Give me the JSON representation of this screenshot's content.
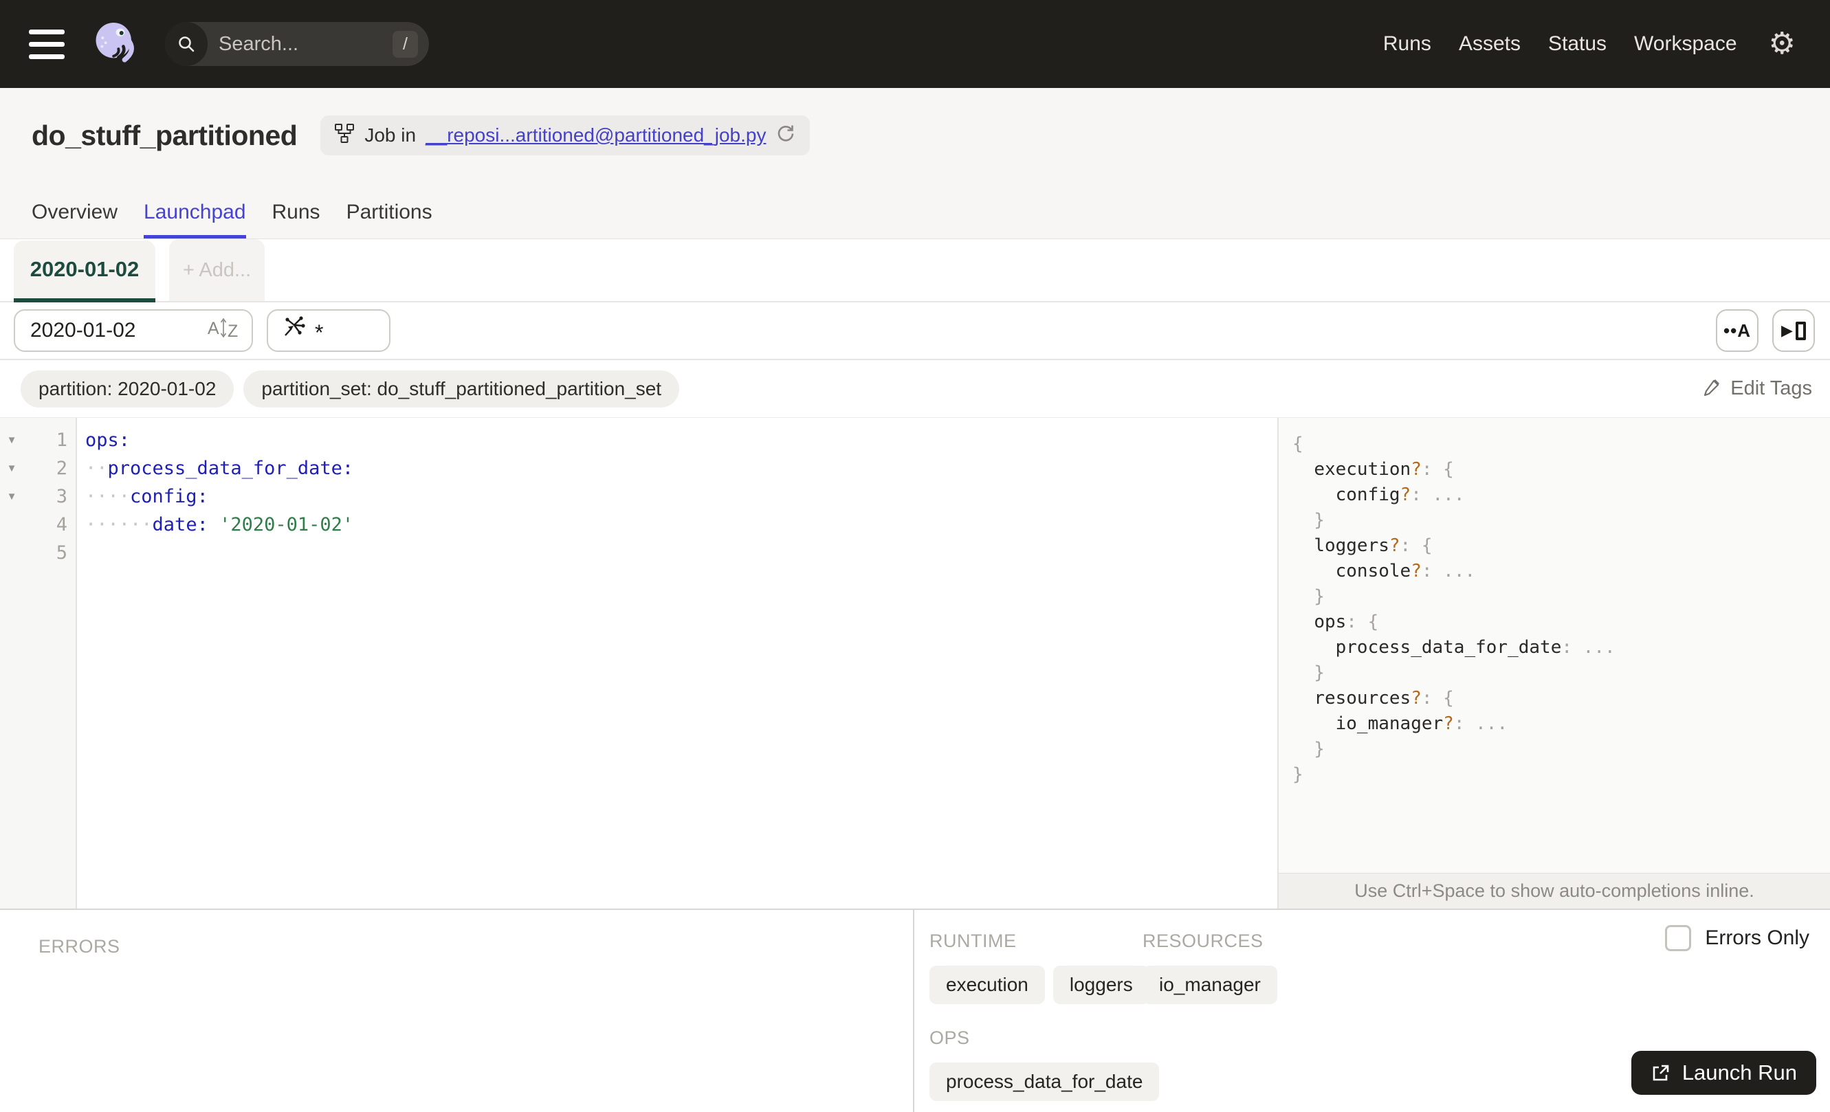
{
  "topbar": {
    "search_placeholder": "Search...",
    "shortcut_key": "/",
    "nav_items": [
      "Runs",
      "Assets",
      "Status",
      "Workspace"
    ]
  },
  "header": {
    "title": "do_stuff_partitioned",
    "job_badge_prefix": "Job in",
    "job_badge_link": "__reposi...artitioned@partitioned_job.py"
  },
  "tabs": [
    {
      "label": "Overview",
      "active": false
    },
    {
      "label": "Launchpad",
      "active": true
    },
    {
      "label": "Runs",
      "active": false
    },
    {
      "label": "Partitions",
      "active": false
    }
  ],
  "partition_tabs": {
    "active_label": "2020-01-02",
    "add_label": "+ Add..."
  },
  "toolbar": {
    "partition_value": "2020-01-02",
    "op_filter_value": "*"
  },
  "tags": {
    "items": [
      "partition: 2020-01-02",
      "partition_set: do_stuff_partitioned_partition_set"
    ],
    "edit_label": "Edit Tags"
  },
  "editor": {
    "lines": [
      {
        "num": "1",
        "fold": true,
        "tokens": [
          [
            "ops:",
            "key"
          ]
        ]
      },
      {
        "num": "2",
        "fold": true,
        "tokens": [
          [
            "··",
            "ws"
          ],
          [
            "process_data_for_date:",
            "key"
          ]
        ]
      },
      {
        "num": "3",
        "fold": true,
        "tokens": [
          [
            "····",
            "ws"
          ],
          [
            "config:",
            "key"
          ]
        ]
      },
      {
        "num": "4",
        "fold": false,
        "tokens": [
          [
            "······",
            "ws"
          ],
          [
            "date:",
            "key"
          ],
          [
            " ",
            "plain"
          ],
          [
            "'2020-01-02'",
            "str"
          ]
        ]
      },
      {
        "num": "5",
        "fold": false,
        "tokens": []
      }
    ]
  },
  "schema": {
    "lines": [
      [
        [
          "{",
          "punct"
        ]
      ],
      [
        [
          "  ",
          "plain"
        ],
        [
          "execution",
          "key"
        ],
        [
          "?",
          "opt"
        ],
        [
          ": ",
          "punct"
        ],
        [
          "{",
          "punct"
        ]
      ],
      [
        [
          "    ",
          "plain"
        ],
        [
          "config",
          "key"
        ],
        [
          "?",
          "opt"
        ],
        [
          ": ",
          "punct"
        ],
        [
          "...",
          "punct"
        ]
      ],
      [
        [
          "  }",
          "punct"
        ]
      ],
      [
        [
          "  ",
          "plain"
        ],
        [
          "loggers",
          "key"
        ],
        [
          "?",
          "opt"
        ],
        [
          ": ",
          "punct"
        ],
        [
          "{",
          "punct"
        ]
      ],
      [
        [
          "    ",
          "plain"
        ],
        [
          "console",
          "key"
        ],
        [
          "?",
          "opt"
        ],
        [
          ": ",
          "punct"
        ],
        [
          "...",
          "punct"
        ]
      ],
      [
        [
          "  }",
          "punct"
        ]
      ],
      [
        [
          "  ",
          "plain"
        ],
        [
          "ops",
          "key"
        ],
        [
          ": ",
          "punct"
        ],
        [
          "{",
          "punct"
        ]
      ],
      [
        [
          "    ",
          "plain"
        ],
        [
          "process_data_for_date",
          "key"
        ],
        [
          ": ",
          "punct"
        ],
        [
          "...",
          "punct"
        ]
      ],
      [
        [
          "  }",
          "punct"
        ]
      ],
      [
        [
          "  ",
          "plain"
        ],
        [
          "resources",
          "key"
        ],
        [
          "?",
          "opt"
        ],
        [
          ": ",
          "punct"
        ],
        [
          "{",
          "punct"
        ]
      ],
      [
        [
          "    ",
          "plain"
        ],
        [
          "io_manager",
          "key"
        ],
        [
          "?",
          "opt"
        ],
        [
          ": ",
          "punct"
        ],
        [
          "...",
          "punct"
        ]
      ],
      [
        [
          "  }",
          "punct"
        ]
      ],
      [
        [
          "}",
          "punct"
        ]
      ]
    ],
    "hint": "Use Ctrl+Space to show auto-completions inline."
  },
  "bottom": {
    "errors_label": "ERRORS",
    "runtime_label": "RUNTIME",
    "runtime_chips": [
      "execution",
      "loggers"
    ],
    "resources_label": "RESOURCES",
    "resources_chips": [
      "io_manager"
    ],
    "ops_label": "OPS",
    "ops_chips": [
      "process_data_for_date"
    ],
    "errors_only_label": "Errors Only",
    "launch_label": "Launch Run"
  },
  "colors": {
    "navbar_bg": "#211f1c",
    "accent_indigo": "#4542d6",
    "partition_green": "#1d4b3f",
    "code_key_blue": "#2020b2",
    "code_string_green": "#2e7d4a",
    "schema_optional_orange": "#b5691e",
    "launch_button_bg": "#211f1c"
  }
}
